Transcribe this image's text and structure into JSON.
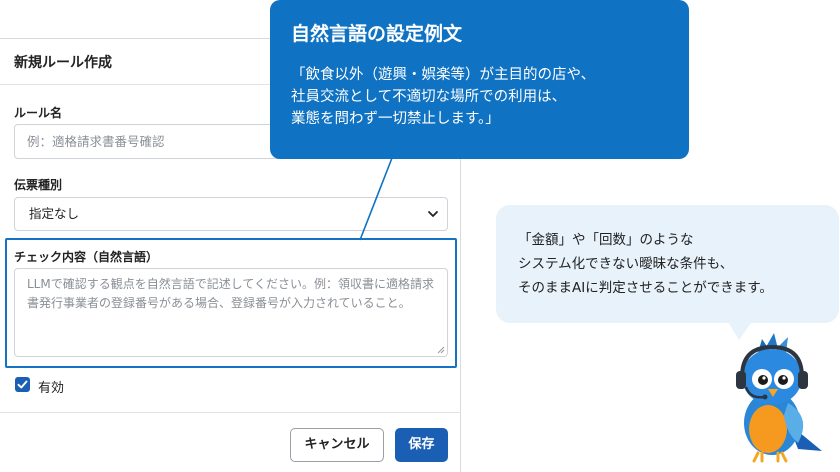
{
  "modal": {
    "title": "新規ルール作成",
    "rule_name": {
      "label": "ルール名",
      "placeholder": "例：適格請求書番号確認"
    },
    "voucher_type": {
      "label": "伝票種別",
      "selected": "指定なし"
    },
    "check_content": {
      "label": "チェック内容（自然言語）",
      "placeholder": "LLMで確認する観点を自然言語で記述してください。例：領収書に適格請求書発行事業者の登録番号がある場合、登録番号が入力されていること。"
    },
    "enabled": {
      "label": "有効",
      "checked": true
    },
    "cancel_label": "キャンセル",
    "save_label": "保存"
  },
  "callout": {
    "title": "自然言語の設定例文",
    "body": "「飲食以外（遊興・娯楽等）が主目的の店や、\n社員交流として不適切な場所での利用は、\n業態を問わず一切禁止します。」"
  },
  "bubble": {
    "text": "「金額」や「回数」のような\nシステム化できない曖昧な条件も、\nそのままAIに判定させることができます。"
  },
  "colors": {
    "accent": "#0f72c2",
    "primary_button": "#1a5fb4",
    "bubble_bg": "#e7f2fb"
  },
  "icons": [
    "chevron-down-icon",
    "checkmark-icon",
    "resize-grip-icon",
    "bird-mascot-icon"
  ]
}
